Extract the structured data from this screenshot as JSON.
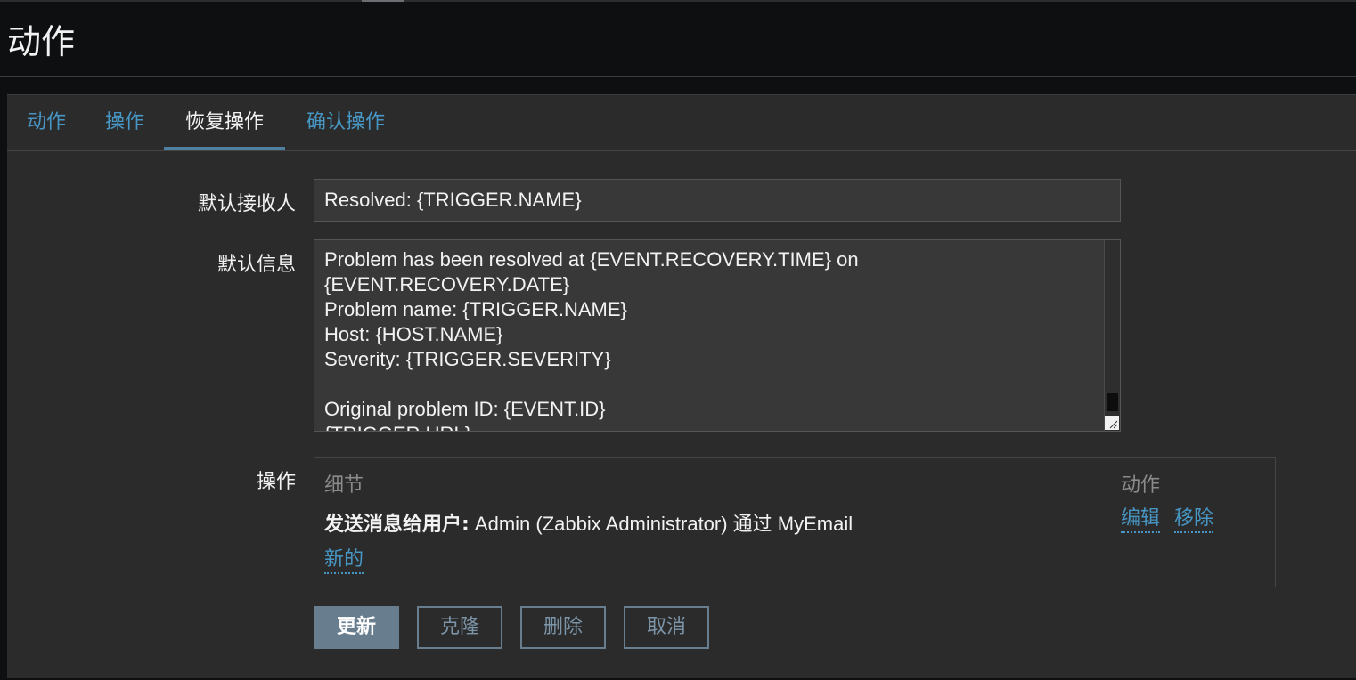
{
  "page": {
    "title": "动作"
  },
  "tabs": [
    {
      "label": "动作"
    },
    {
      "label": "操作"
    },
    {
      "label": "恢复操作"
    },
    {
      "label": "确认操作"
    }
  ],
  "form": {
    "default_subject_label": "默认接收人",
    "default_subject_value": "Resolved: {TRIGGER.NAME}",
    "default_message_label": "默认信息",
    "default_message_value": "Problem has been resolved at {EVENT.RECOVERY.TIME} on\n{EVENT.RECOVERY.DATE}\nProblem name: {TRIGGER.NAME}\nHost: {HOST.NAME}\nSeverity: {TRIGGER.SEVERITY}\n\nOriginal problem ID: {EVENT.ID}\n{TRIGGER.URL}",
    "operations_label": "操作"
  },
  "operations": {
    "header_details": "细节",
    "header_action": "动作",
    "rows": [
      {
        "detail_prefix": "发送消息给用户:",
        "detail_text": " Admin (Zabbix Administrator) 通过 MyEmail",
        "edit_label": "编辑",
        "remove_label": "移除"
      }
    ],
    "new_label": "新的"
  },
  "buttons": {
    "update": "更新",
    "clone": "克隆",
    "delete": "删除",
    "cancel": "取消"
  },
  "colors": {
    "link": "#4796c4",
    "primary_button": "#687d8d",
    "panel_bg": "#2b2b2b",
    "page_bg": "#0e0f10"
  }
}
